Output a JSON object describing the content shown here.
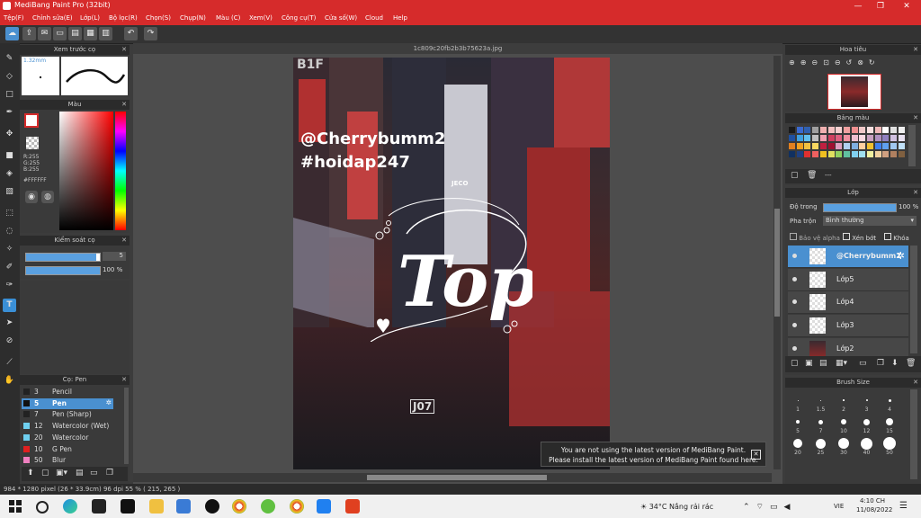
{
  "window": {
    "title": "MediBang Paint Pro (32bit)",
    "controls": [
      "—",
      "❐",
      "✕"
    ]
  },
  "menu": [
    "Tệp(F)",
    "Chỉnh sửa(E)",
    "Lớp(L)",
    "Bộ lọc(R)",
    "Chọn(S)",
    "Chụp(N)",
    "Màu (C)",
    "Xem(V)",
    "Công cụ(T)",
    "Cửa số(W)",
    "Cloud",
    "Help"
  ],
  "document": {
    "filename": "1c809c20fb2b3b75623a.jpg",
    "watermark_line1": "@Cherrybumm2",
    "watermark_line2": "#hoidap247",
    "sign_b1f": "B1F",
    "sign_jeco": "JECO",
    "sign_j07": "J07",
    "logo_text": "Top"
  },
  "preview_panel": {
    "title": "Xem trước cọ",
    "size": "1.32mm"
  },
  "color_panel": {
    "title": "Màu",
    "r": "R:255",
    "g": "G:255",
    "b": "B:255",
    "hex": "#FFFFFF"
  },
  "brush_control": {
    "title": "Kiểm soát cọ",
    "size_value": "5",
    "opacity_value": "100 %",
    "size_fill": 0.95,
    "opacity_fill": 1.0
  },
  "brush_list": {
    "title": "Cọ: Pen",
    "items": [
      {
        "num": "3",
        "label": "Pencil",
        "color": "#222222",
        "selected": false
      },
      {
        "num": "5",
        "label": "Pen",
        "color": "#111111",
        "selected": true
      },
      {
        "num": "7",
        "label": "Pen (Sharp)",
        "color": "#222222",
        "selected": false
      },
      {
        "num": "12",
        "label": "Watercolor (Wet)",
        "color": "#6fd0f0",
        "selected": false
      },
      {
        "num": "20",
        "label": "Watercolor",
        "color": "#6fd0f0",
        "selected": false
      },
      {
        "num": "10",
        "label": "G Pen",
        "color": "#e02020",
        "selected": false
      },
      {
        "num": "50",
        "label": "Blur",
        "color": "#f080c0",
        "selected": false
      }
    ]
  },
  "navigator": {
    "title": "Hoa tiêu"
  },
  "palette": {
    "title": "Bảng màu",
    "dash": "---",
    "colors": [
      "#1a1a1a",
      "#3a6ad0",
      "#3060b0",
      "#a0a0a0",
      "#f0b0b0",
      "#f4c0c0",
      "#f8d0d0",
      "#f0a0a0",
      "#f09090",
      "#f0c8c8",
      "#f8e0e0",
      "#f0b8b8",
      "#ffffff",
      "#e0e0e0",
      "#f0f0f0",
      "#2050a0",
      "#40a0e0",
      "#60c0f0",
      "#c0c0c0",
      "#f0a0b0",
      "#d04060",
      "#e06080",
      "#f090a0",
      "#f0c0d0",
      "#f8d8e0",
      "#c8a0c0",
      "#b090c0",
      "#9080c0",
      "#d0c0e0",
      "#e8e0f0",
      "#e08020",
      "#f0a020",
      "#f0c040",
      "#f8d860",
      "#c02040",
      "#a01030",
      "#e0a0c0",
      "#b0d0f0",
      "#80b0e0",
      "#ffd0a0",
      "#f0c030",
      "#4080f0",
      "#60a0f0",
      "#a0c8f0",
      "#c0e0f8",
      "#103060",
      "#204080",
      "#e03030",
      "#f06060",
      "#f0c020",
      "#e0e060",
      "#90d060",
      "#60c0a0",
      "#80d0f0",
      "#a0e0f0",
      "#f0f0a0",
      "#f0d0a0",
      "#d0a080",
      "#b08060",
      "#806040"
    ]
  },
  "layer_panel": {
    "title": "Lớp",
    "opacity_label": "Độ trong",
    "opacity_value": "100 %",
    "opacity_fill": 1.0,
    "blend_label": "Pha trộn",
    "blend_value": "Bình thường",
    "alpha_label": "Bảo vệ alpha",
    "clip_label": "Xén bớt",
    "lock_label": "Khóa",
    "layers": [
      {
        "name": "@Cherrybumm2",
        "selected": true
      },
      {
        "name": "Lớp5",
        "selected": false
      },
      {
        "name": "Lớp4",
        "selected": false
      },
      {
        "name": "Lớp3",
        "selected": false
      },
      {
        "name": "Lớp2",
        "selected": false
      }
    ]
  },
  "brush_size_panel": {
    "title": "Brush Size",
    "labels": [
      "1",
      "1.5",
      "2",
      "3",
      "4",
      "5",
      "7",
      "10",
      "12",
      "15",
      "20",
      "25",
      "30",
      "40",
      "50"
    ]
  },
  "notification": {
    "line1": "You are not using the latest version of MediBang Paint.",
    "line2": "Please install the latest version of MediBang Paint found here."
  },
  "statusbar": {
    "text": "984 * 1280 pixel  (26 * 33.9cm)  96 dpi  55 %  ( 215, 265 )"
  },
  "taskbar": {
    "weather": "34°C  Nắng rải rác",
    "lang": "VIE",
    "time": "4:10 CH",
    "date": "11/08/2022"
  }
}
